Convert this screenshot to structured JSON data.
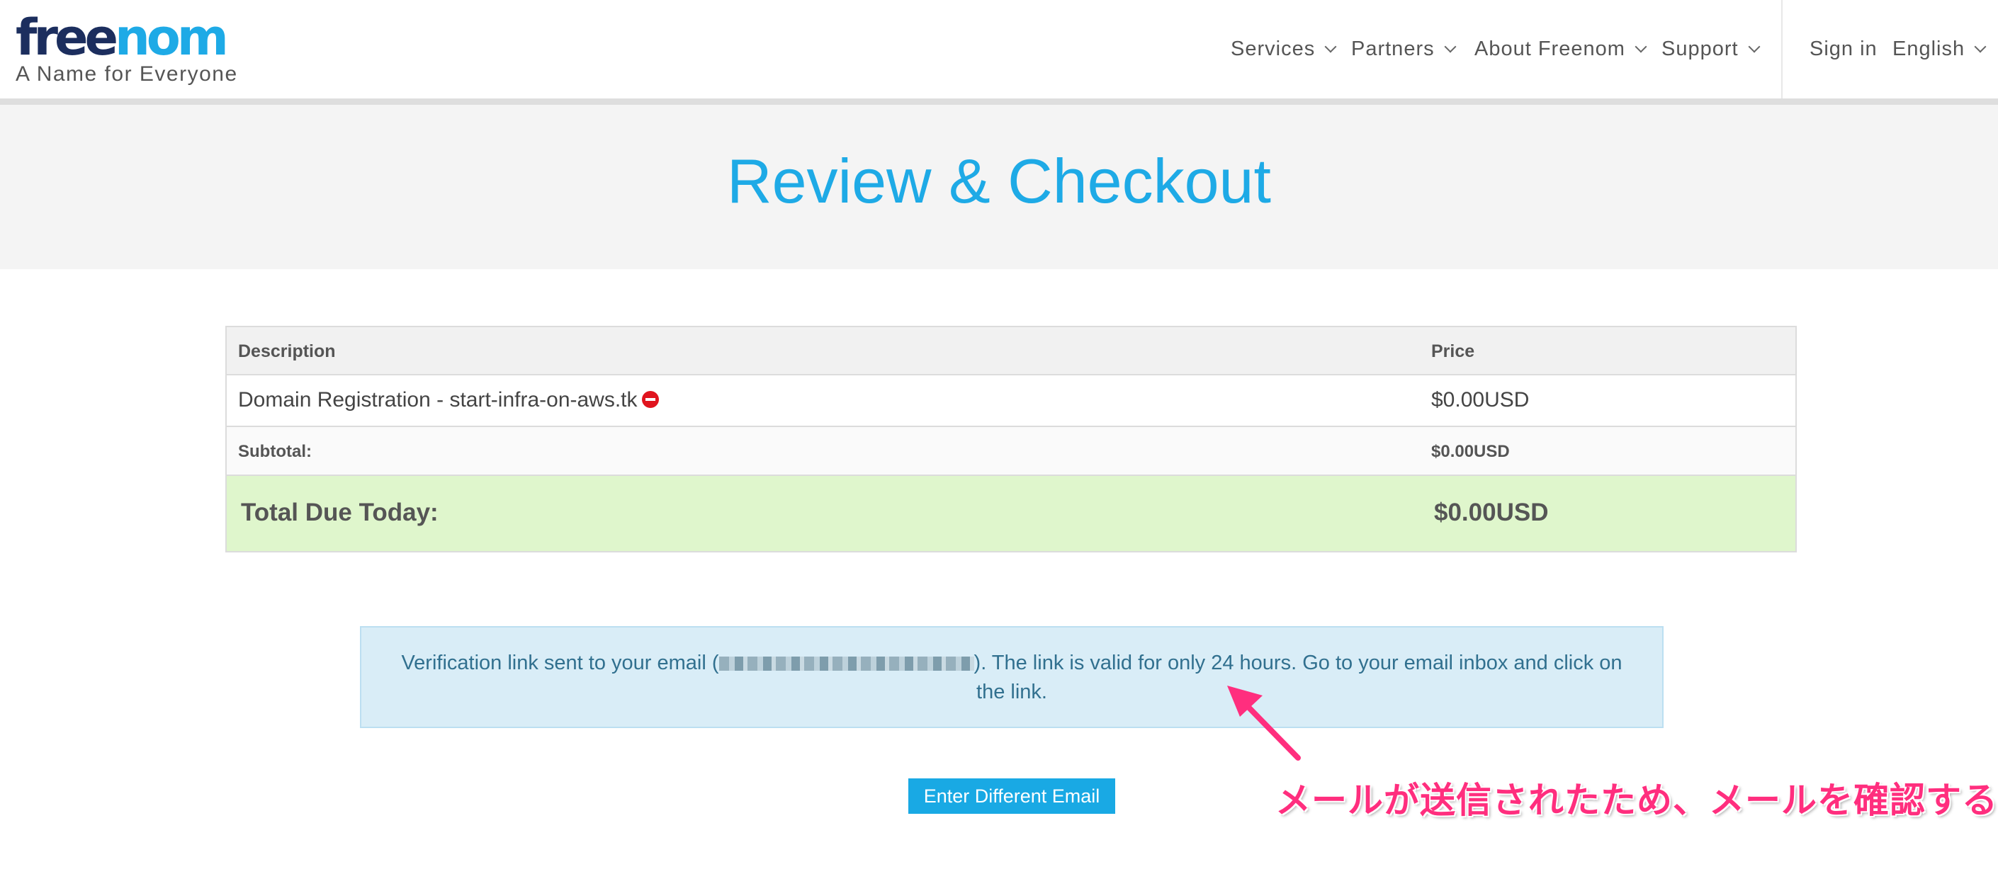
{
  "logo": {
    "wordmark_part1": "free",
    "wordmark_part2": "nom",
    "tagline": "A Name for Everyone"
  },
  "nav": {
    "items": [
      {
        "label": "Services"
      },
      {
        "label": "Partners"
      },
      {
        "label": "About Freenom"
      },
      {
        "label": "Support"
      }
    ],
    "sign_in": "Sign in",
    "language": "English"
  },
  "page": {
    "title": "Review & Checkout"
  },
  "cart": {
    "headers": {
      "description": "Description",
      "price": "Price"
    },
    "items": [
      {
        "description": "Domain Registration - start-infra-on-aws.tk",
        "price": "$0.00USD"
      }
    ],
    "subtotal": {
      "label": "Subtotal:",
      "value": "$0.00USD"
    },
    "total": {
      "label": "Total Due Today:",
      "value": "$0.00USD"
    }
  },
  "alert": {
    "text_before": "Verification link sent to your email (",
    "text_after": "). The link is valid for only 24 hours. Go to your email inbox and click on the link."
  },
  "button": {
    "enter_different_email": "Enter Different Email"
  },
  "annotation": {
    "text": "メールが送信されたため、メールを確認する"
  },
  "colors": {
    "brand_blue": "#1eaae6",
    "brand_navy": "#1c2e5e",
    "total_bg": "#dff6cc",
    "alert_bg": "#d9edf7",
    "annotation": "#ff2e7e"
  }
}
